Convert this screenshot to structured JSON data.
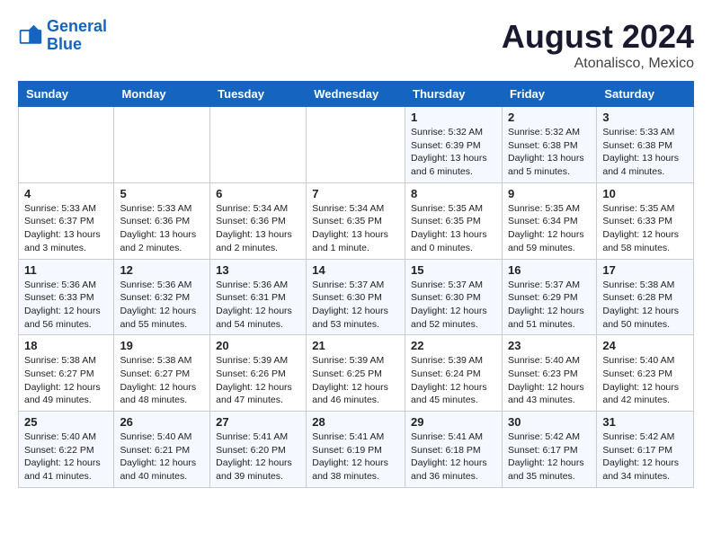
{
  "header": {
    "logo_line1": "General",
    "logo_line2": "Blue",
    "month_year": "August 2024",
    "location": "Atonalisco, Mexico"
  },
  "days_of_week": [
    "Sunday",
    "Monday",
    "Tuesday",
    "Wednesday",
    "Thursday",
    "Friday",
    "Saturday"
  ],
  "weeks": [
    [
      {
        "day": "",
        "info": ""
      },
      {
        "day": "",
        "info": ""
      },
      {
        "day": "",
        "info": ""
      },
      {
        "day": "",
        "info": ""
      },
      {
        "day": "1",
        "info": "Sunrise: 5:32 AM\nSunset: 6:39 PM\nDaylight: 13 hours\nand 6 minutes."
      },
      {
        "day": "2",
        "info": "Sunrise: 5:32 AM\nSunset: 6:38 PM\nDaylight: 13 hours\nand 5 minutes."
      },
      {
        "day": "3",
        "info": "Sunrise: 5:33 AM\nSunset: 6:38 PM\nDaylight: 13 hours\nand 4 minutes."
      }
    ],
    [
      {
        "day": "4",
        "info": "Sunrise: 5:33 AM\nSunset: 6:37 PM\nDaylight: 13 hours\nand 3 minutes."
      },
      {
        "day": "5",
        "info": "Sunrise: 5:33 AM\nSunset: 6:36 PM\nDaylight: 13 hours\nand 2 minutes."
      },
      {
        "day": "6",
        "info": "Sunrise: 5:34 AM\nSunset: 6:36 PM\nDaylight: 13 hours\nand 2 minutes."
      },
      {
        "day": "7",
        "info": "Sunrise: 5:34 AM\nSunset: 6:35 PM\nDaylight: 13 hours\nand 1 minute."
      },
      {
        "day": "8",
        "info": "Sunrise: 5:35 AM\nSunset: 6:35 PM\nDaylight: 13 hours\nand 0 minutes."
      },
      {
        "day": "9",
        "info": "Sunrise: 5:35 AM\nSunset: 6:34 PM\nDaylight: 12 hours\nand 59 minutes."
      },
      {
        "day": "10",
        "info": "Sunrise: 5:35 AM\nSunset: 6:33 PM\nDaylight: 12 hours\nand 58 minutes."
      }
    ],
    [
      {
        "day": "11",
        "info": "Sunrise: 5:36 AM\nSunset: 6:33 PM\nDaylight: 12 hours\nand 56 minutes."
      },
      {
        "day": "12",
        "info": "Sunrise: 5:36 AM\nSunset: 6:32 PM\nDaylight: 12 hours\nand 55 minutes."
      },
      {
        "day": "13",
        "info": "Sunrise: 5:36 AM\nSunset: 6:31 PM\nDaylight: 12 hours\nand 54 minutes."
      },
      {
        "day": "14",
        "info": "Sunrise: 5:37 AM\nSunset: 6:30 PM\nDaylight: 12 hours\nand 53 minutes."
      },
      {
        "day": "15",
        "info": "Sunrise: 5:37 AM\nSunset: 6:30 PM\nDaylight: 12 hours\nand 52 minutes."
      },
      {
        "day": "16",
        "info": "Sunrise: 5:37 AM\nSunset: 6:29 PM\nDaylight: 12 hours\nand 51 minutes."
      },
      {
        "day": "17",
        "info": "Sunrise: 5:38 AM\nSunset: 6:28 PM\nDaylight: 12 hours\nand 50 minutes."
      }
    ],
    [
      {
        "day": "18",
        "info": "Sunrise: 5:38 AM\nSunset: 6:27 PM\nDaylight: 12 hours\nand 49 minutes."
      },
      {
        "day": "19",
        "info": "Sunrise: 5:38 AM\nSunset: 6:27 PM\nDaylight: 12 hours\nand 48 minutes."
      },
      {
        "day": "20",
        "info": "Sunrise: 5:39 AM\nSunset: 6:26 PM\nDaylight: 12 hours\nand 47 minutes."
      },
      {
        "day": "21",
        "info": "Sunrise: 5:39 AM\nSunset: 6:25 PM\nDaylight: 12 hours\nand 46 minutes."
      },
      {
        "day": "22",
        "info": "Sunrise: 5:39 AM\nSunset: 6:24 PM\nDaylight: 12 hours\nand 45 minutes."
      },
      {
        "day": "23",
        "info": "Sunrise: 5:40 AM\nSunset: 6:23 PM\nDaylight: 12 hours\nand 43 minutes."
      },
      {
        "day": "24",
        "info": "Sunrise: 5:40 AM\nSunset: 6:23 PM\nDaylight: 12 hours\nand 42 minutes."
      }
    ],
    [
      {
        "day": "25",
        "info": "Sunrise: 5:40 AM\nSunset: 6:22 PM\nDaylight: 12 hours\nand 41 minutes."
      },
      {
        "day": "26",
        "info": "Sunrise: 5:40 AM\nSunset: 6:21 PM\nDaylight: 12 hours\nand 40 minutes."
      },
      {
        "day": "27",
        "info": "Sunrise: 5:41 AM\nSunset: 6:20 PM\nDaylight: 12 hours\nand 39 minutes."
      },
      {
        "day": "28",
        "info": "Sunrise: 5:41 AM\nSunset: 6:19 PM\nDaylight: 12 hours\nand 38 minutes."
      },
      {
        "day": "29",
        "info": "Sunrise: 5:41 AM\nSunset: 6:18 PM\nDaylight: 12 hours\nand 36 minutes."
      },
      {
        "day": "30",
        "info": "Sunrise: 5:42 AM\nSunset: 6:17 PM\nDaylight: 12 hours\nand 35 minutes."
      },
      {
        "day": "31",
        "info": "Sunrise: 5:42 AM\nSunset: 6:17 PM\nDaylight: 12 hours\nand 34 minutes."
      }
    ]
  ]
}
